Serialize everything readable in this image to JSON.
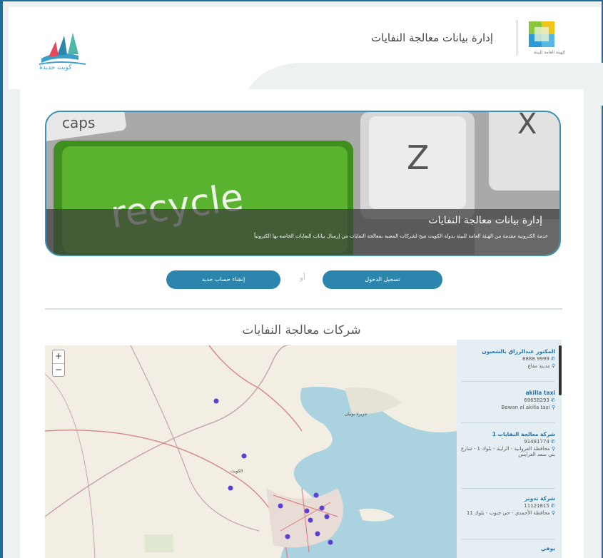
{
  "header": {
    "title": "إدارة بيانات معالجة النفايات",
    "org_caption": "الهيئة العامة للبيئة",
    "kuwait_caption": "كويت جديدة"
  },
  "banner": {
    "image_text": "recycle",
    "key_z": "Z",
    "key_x": "X",
    "key_caps": "caps",
    "title": "إدارة بيانات معالجة النفايات",
    "description": "خدمة الكترونية مقدمة من الهيئة العامة للبيئة بدولة الكويت تتيح لشركات المعنية بمعالجة النفايات من إرسال بيانات النفايات الخاصة بها الكترونياً"
  },
  "actions": {
    "login_label": "تسجيل الدخول",
    "or_label": "أو",
    "register_label": "إنشاء حساب جديد"
  },
  "section": {
    "title": "شركات معالجة النفايات"
  },
  "map": {
    "zoom_in": "+",
    "zoom_out": "−",
    "place_label_1": "جزيرة بوبيان",
    "place_label_2": "الكويت"
  },
  "companies": [
    {
      "name": "المكتور عبدالرزاق بالشعيون",
      "phone": "9999 8888",
      "location": "مدينة مقاع"
    },
    {
      "name": "akilla taxi",
      "phone": "69658293",
      "location": "Bewan el akilla taxi"
    },
    {
      "name": "شركة معالجة النفايات 1",
      "phone": "91481774",
      "location": "محافظة الفروانية - الرابية - بلوك 1 - شارع بني سعد العرايس"
    },
    {
      "name": "شركة تدوير",
      "phone": "11121815",
      "location": "محافظة الأحمدي - حي جنوب - بلوك 11"
    },
    {
      "name": "يوفي",
      "phone": "",
      "location": ""
    }
  ],
  "colors": {
    "frame": "#1f6f99",
    "button": "#2b85ad",
    "company_name": "#2a70a5",
    "banner_key_green": "#5ab32e"
  }
}
